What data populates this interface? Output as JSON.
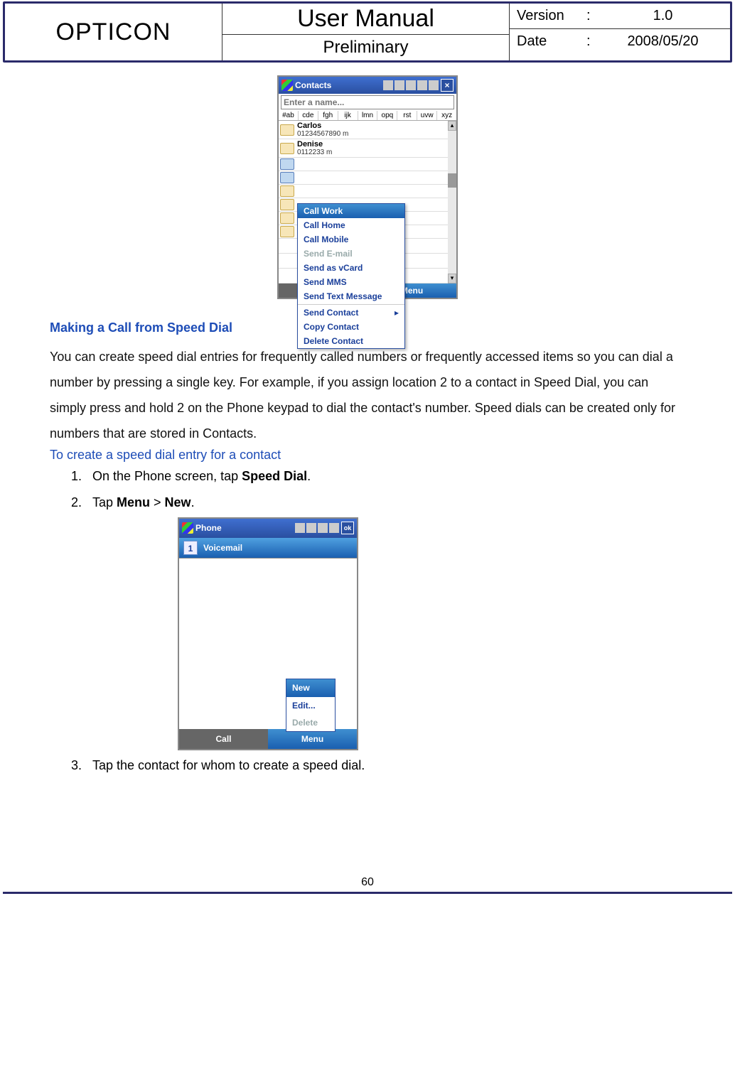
{
  "header": {
    "brand": "OPTICON",
    "title": "User Manual",
    "subtitle": "Preliminary",
    "version_label": "Version",
    "version_value": "1.0",
    "date_label": "Date",
    "date_value": "2008/05/20",
    "colon": ":"
  },
  "shot1": {
    "title": "Contacts",
    "placeholder": "Enter a name...",
    "alpha": [
      "#ab",
      "cde",
      "fgh",
      "ijk",
      "lmn",
      "opq",
      "rst",
      "uvw",
      "xyz"
    ],
    "contacts": [
      {
        "name": "Carlos",
        "num": "01234567890   m"
      },
      {
        "name": "Denise",
        "num": "0112233   m"
      }
    ],
    "menu": [
      "Call Work",
      "Call Home",
      "Call Mobile",
      "Send E-mail",
      "Send as vCard",
      "Send MMS",
      "Send Text Message",
      "Send Contact",
      "Copy Contact",
      "Delete Contact"
    ],
    "soft_right": "Menu"
  },
  "section": {
    "heading": "Making a Call from Speed Dial",
    "para": "You can create speed dial entries for frequently called numbers or frequently accessed items so you can dial a number by pressing a single key. For example, if you assign location 2 to a contact in Speed Dial, you can simply press and hold 2 on the Phone keypad to dial the contact's number. Speed dials can be created only for numbers that are stored in Contacts.",
    "subhead": "To create a speed dial entry for a contact",
    "step1_a": "On the Phone screen, tap ",
    "step1_b": "Speed Dial",
    "step1_c": ".",
    "step2_a": "Tap ",
    "step2_b": "Menu",
    "step2_c": " > ",
    "step2_d": "New",
    "step2_e": ".",
    "step3": "Tap the contact for whom to create a speed dial."
  },
  "shot2": {
    "title": "Phone",
    "ok": "ok",
    "vm_num": "1",
    "vm_label": "Voicemail",
    "soft_left": "Call",
    "soft_right": "Menu",
    "menu": [
      "New",
      "Edit...",
      "Delete"
    ]
  },
  "page_number": "60"
}
